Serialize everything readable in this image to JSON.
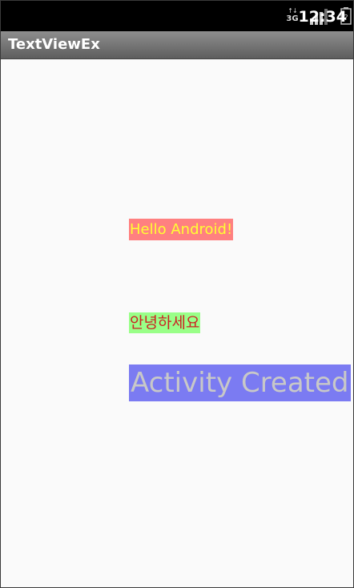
{
  "status_bar": {
    "network_icon": "3g-data-icon",
    "network_label": "3G",
    "network_arrows": "↑↓",
    "signal_icon": "signal-strength-icon",
    "battery_icon": "battery-unknown-icon",
    "battery_symbol": "?",
    "clock": "12:34"
  },
  "title_bar": {
    "title": "TextViewEx"
  },
  "text_views": {
    "hello": {
      "text": "Hello Android!",
      "text_color": "#ffff33",
      "background_color": "#ff8080"
    },
    "korean": {
      "text": "안녕하세요",
      "text_color": "#cc2222",
      "background_color": "#99ff88"
    },
    "activity": {
      "text": "Activity Created",
      "text_color": "#c8c8c8",
      "background_color": "#7b7bf2"
    }
  }
}
